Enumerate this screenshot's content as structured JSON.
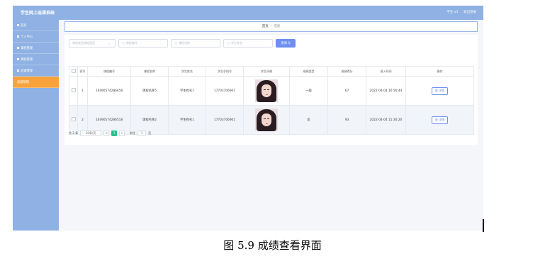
{
  "app": {
    "title": "学生网上选课系统"
  },
  "top_right": {
    "user": "学生 a1",
    "logout": "退出登录"
  },
  "sidebar": {
    "items": [
      {
        "label": "首页"
      },
      {
        "label": "个人中心"
      },
      {
        "label": "课程管理"
      },
      {
        "label": "课程管理"
      },
      {
        "label": "选课管理"
      },
      {
        "label": "成绩管理"
      }
    ]
  },
  "breadcrumb": {
    "home": "首页",
    "separator": "/",
    "current": "成绩"
  },
  "search": {
    "type_placeholder": "课程类型课程类型",
    "course_id_placeholder": "课程编号",
    "course_name_placeholder": "课程名称",
    "student_name_placeholder": "学生姓名",
    "query_label": "查询 Q"
  },
  "table": {
    "headers": [
      "索引",
      "课程编号",
      "课程名称",
      "学生姓名",
      "学生手机号",
      "学生头像",
      "成绩类型",
      "成绩得分",
      "录入时间",
      "操作"
    ],
    "rows": [
      {
        "index": "1",
        "course_id": "16490574286658",
        "course_name": "课程名称5",
        "student_name": "学生姓名1",
        "phone": "17703706901",
        "grade_type": "一般",
        "score": "67",
        "time": "2022-04-04 16:56:44",
        "action": "查 详情"
      },
      {
        "index": "2",
        "course_id": "16490574286518",
        "course_name": "课程名称2",
        "student_name": "学生姓名1",
        "phone": "17703706901",
        "grade_type": "差",
        "score": "93",
        "time": "2022-04-04 15:30:20",
        "action": "查 详情"
      }
    ]
  },
  "pagination": {
    "total": "共 2 条",
    "page_size": "10条/页",
    "prev": "<",
    "current_page": "1",
    "next": ">",
    "goto_label": "前往",
    "goto_value": "1",
    "page_unit": "页"
  },
  "caption": "图 5.9  成绩查看界面"
}
